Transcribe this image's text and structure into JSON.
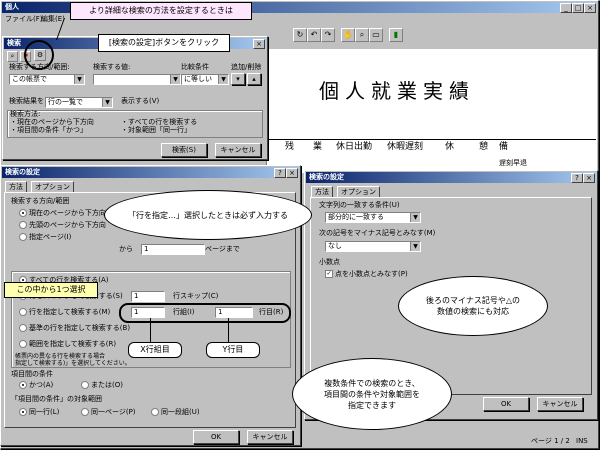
{
  "main_window": {
    "title": "個人",
    "menu": [
      "ファイル(F)",
      "編集(E)"
    ],
    "report_title": "個人就業実績",
    "columns": [
      "残",
      "業",
      "休日出勤",
      "休暇遅刻",
      "休",
      "憩",
      "備"
    ],
    "remark": "遅刻早退",
    "status_page": "ページ 1 / 2",
    "status_ins": "INS"
  },
  "search_small": {
    "title": "検索",
    "direction_label": "検索する方向/範囲:",
    "direction_value": "この帳票で",
    "value_label": "検索する値:",
    "compare_label": "比較条件",
    "compare_value": "に等しい",
    "addremove_label": "追加/削除",
    "result_label": "検索結果を",
    "result_value": "行の一覧で",
    "result_suffix": "表示する(V)",
    "method_label": "検索方法:",
    "method_lines": [
      "・現在のページから下方向",
      "・項目間の条件「かつ」",
      "・すべての行を検索する",
      "・対象範囲「同一行」"
    ],
    "search_button": "検索(S)",
    "cancel_button": "キャンセル"
  },
  "settings_left": {
    "title": "検索の設定",
    "tabs": [
      "方法",
      "オプション"
    ],
    "direction_group": "検索する方向/範囲",
    "direction_options": [
      "現在のページから下方向",
      "先頭のページから下方向",
      "指定ページ(I)"
    ],
    "page_from_label": "から",
    "page_from_value": "1",
    "page_to_label": "ページまで",
    "row_options": [
      "すべての行を検索する(A)",
      "行をスキップして検索する(S)",
      "行を指定して検索する(M)",
      "基準の行を指定して検索する(B)",
      "範囲を指定して検索する(R)"
    ],
    "skip_value": "1",
    "skip_label": "行スキップ(C)",
    "row_group_value": "1",
    "row_group_label": "行組(I)",
    "row_value": "1",
    "row_label": "行目(R)",
    "note_line1": "帳票内の異なる行を検索する場合",
    "note_line2": "指定して検索する)」を選択してください。",
    "item_cond_label": "項目間の条件",
    "and_option": "かつ(A)",
    "or_option": "または(O)",
    "scope_label": "「項目間の条件」の対象範囲",
    "scope_options": [
      "同一行(L)",
      "同一ページ(P)",
      "同一段組(U)"
    ],
    "ok_button": "OK",
    "cancel_button": "キャンセル"
  },
  "settings_right": {
    "title": "検索の設定",
    "tabs": [
      "方法",
      "オプション"
    ],
    "string_match_label": "文字列の一致する条件(U)",
    "string_match_value": "部分的に一致する",
    "minus_label": "次の記号をマイナス記号とみなす(M)",
    "minus_value": "なし",
    "decimal_label": "小数点",
    "decimal_checkbox": "点を小数点とみなす(P)",
    "ok_button": "OK",
    "cancel_button": "キャンセル"
  },
  "annotations": {
    "top_note": "より詳細な検索の方法を設定するときは",
    "button_note": "[検索の設定]ボタンをクリック",
    "select_note": "この中から1つ選択",
    "cloud_row": "「行を指定…」選択したときは必ず入力する",
    "label_x": "X行組目",
    "label_y": "Y行目",
    "cloud_multi_line1": "複数条件での検索のとき、",
    "cloud_multi_line2": "項目間の条件や対象範囲を",
    "cloud_multi_line3": "指定できます",
    "cloud_minus_line1": "後ろのマイナス記号や△の",
    "cloud_minus_line2": "数値の検索にも対応"
  }
}
